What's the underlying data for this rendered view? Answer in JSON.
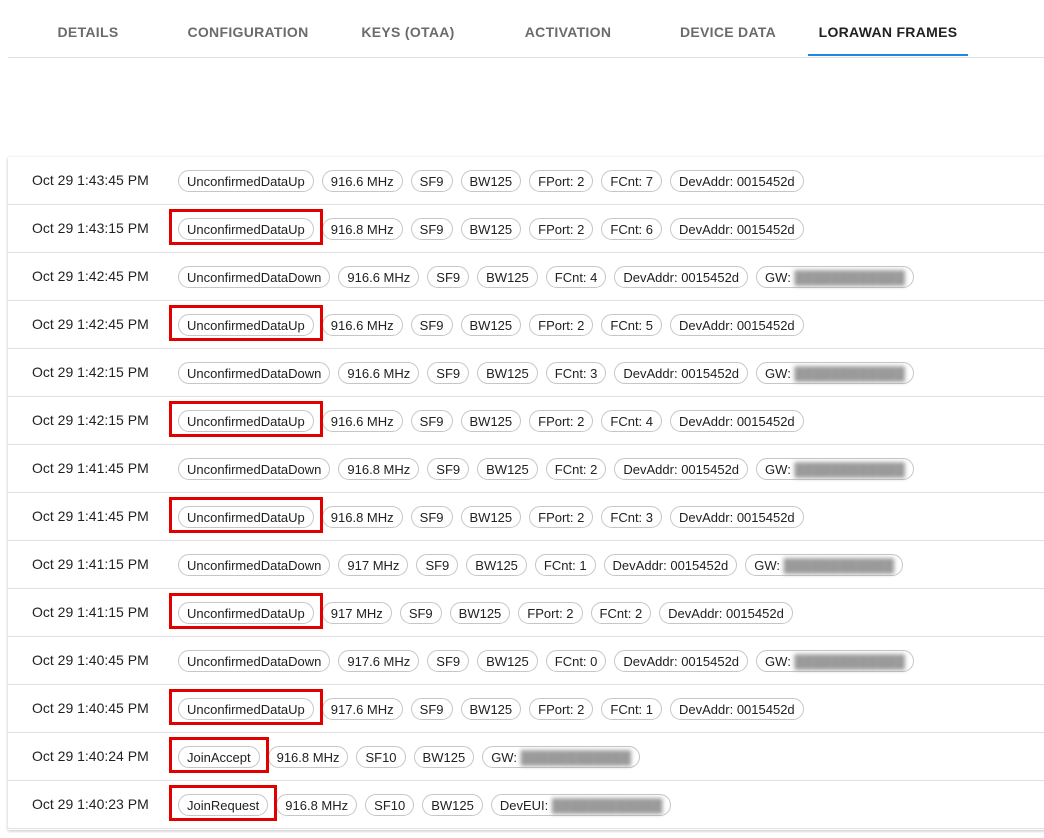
{
  "tabs": [
    {
      "label": "DETAILS"
    },
    {
      "label": "CONFIGURATION"
    },
    {
      "label": "KEYS (OTAA)"
    },
    {
      "label": "ACTIVATION"
    },
    {
      "label": "DEVICE DATA"
    },
    {
      "label": "LORAWAN FRAMES",
      "active": true
    }
  ],
  "colors": {
    "active_tab_indicator": "#1e88e5",
    "highlight_box": "#e00000"
  },
  "frames": [
    {
      "time": "Oct 29 1:43:45 PM",
      "chips": [
        "UnconfirmedDataUp",
        "916.6 MHz",
        "SF9",
        "BW125",
        "FPort: 2",
        "FCnt: 7",
        "DevAddr: 0015452d"
      ]
    },
    {
      "time": "Oct 29 1:43:15 PM",
      "chips": [
        "UnconfirmedDataUp",
        "916.8 MHz",
        "SF9",
        "BW125",
        "FPort: 2",
        "FCnt: 6",
        "DevAddr: 0015452d"
      ],
      "highlighted": true
    },
    {
      "time": "Oct 29 1:42:45 PM",
      "chips": [
        "UnconfirmedDataDown",
        "916.6 MHz",
        "SF9",
        "BW125",
        "FCnt: 4",
        "DevAddr: 0015452d",
        "GW:"
      ]
    },
    {
      "time": "Oct 29 1:42:45 PM",
      "chips": [
        "UnconfirmedDataUp",
        "916.6 MHz",
        "SF9",
        "BW125",
        "FPort: 2",
        "FCnt: 5",
        "DevAddr: 0015452d"
      ],
      "highlighted": true
    },
    {
      "time": "Oct 29 1:42:15 PM",
      "chips": [
        "UnconfirmedDataDown",
        "916.6 MHz",
        "SF9",
        "BW125",
        "FCnt: 3",
        "DevAddr: 0015452d",
        "GW:"
      ]
    },
    {
      "time": "Oct 29 1:42:15 PM",
      "chips": [
        "UnconfirmedDataUp",
        "916.6 MHz",
        "SF9",
        "BW125",
        "FPort: 2",
        "FCnt: 4",
        "DevAddr: 0015452d"
      ],
      "highlighted": true
    },
    {
      "time": "Oct 29 1:41:45 PM",
      "chips": [
        "UnconfirmedDataDown",
        "916.8 MHz",
        "SF9",
        "BW125",
        "FCnt: 2",
        "DevAddr: 0015452d",
        "GW:"
      ]
    },
    {
      "time": "Oct 29 1:41:45 PM",
      "chips": [
        "UnconfirmedDataUp",
        "916.8 MHz",
        "SF9",
        "BW125",
        "FPort: 2",
        "FCnt: 3",
        "DevAddr: 0015452d"
      ],
      "highlighted": true
    },
    {
      "time": "Oct 29 1:41:15 PM",
      "chips": [
        "UnconfirmedDataDown",
        "917 MHz",
        "SF9",
        "BW125",
        "FCnt: 1",
        "DevAddr: 0015452d",
        "GW:"
      ]
    },
    {
      "time": "Oct 29 1:41:15 PM",
      "chips": [
        "UnconfirmedDataUp",
        "917 MHz",
        "SF9",
        "BW125",
        "FPort: 2",
        "FCnt: 2",
        "DevAddr: 0015452d"
      ],
      "highlighted": true
    },
    {
      "time": "Oct 29 1:40:45 PM",
      "chips": [
        "UnconfirmedDataDown",
        "917.6 MHz",
        "SF9",
        "BW125",
        "FCnt: 0",
        "DevAddr: 0015452d",
        "GW:"
      ]
    },
    {
      "time": "Oct 29 1:40:45 PM",
      "chips": [
        "UnconfirmedDataUp",
        "917.6 MHz",
        "SF9",
        "BW125",
        "FPort: 2",
        "FCnt: 1",
        "DevAddr: 0015452d"
      ],
      "highlighted": true
    },
    {
      "time": "Oct 29 1:40:24 PM",
      "chips": [
        "JoinAccept",
        "916.8 MHz",
        "SF10",
        "BW125",
        "GW:"
      ],
      "highlighted": true
    },
    {
      "time": "Oct 29 1:40:23 PM",
      "chips": [
        "JoinRequest",
        "916.8 MHz",
        "SF10",
        "BW125",
        "DevEUI:"
      ],
      "highlighted": true
    }
  ]
}
